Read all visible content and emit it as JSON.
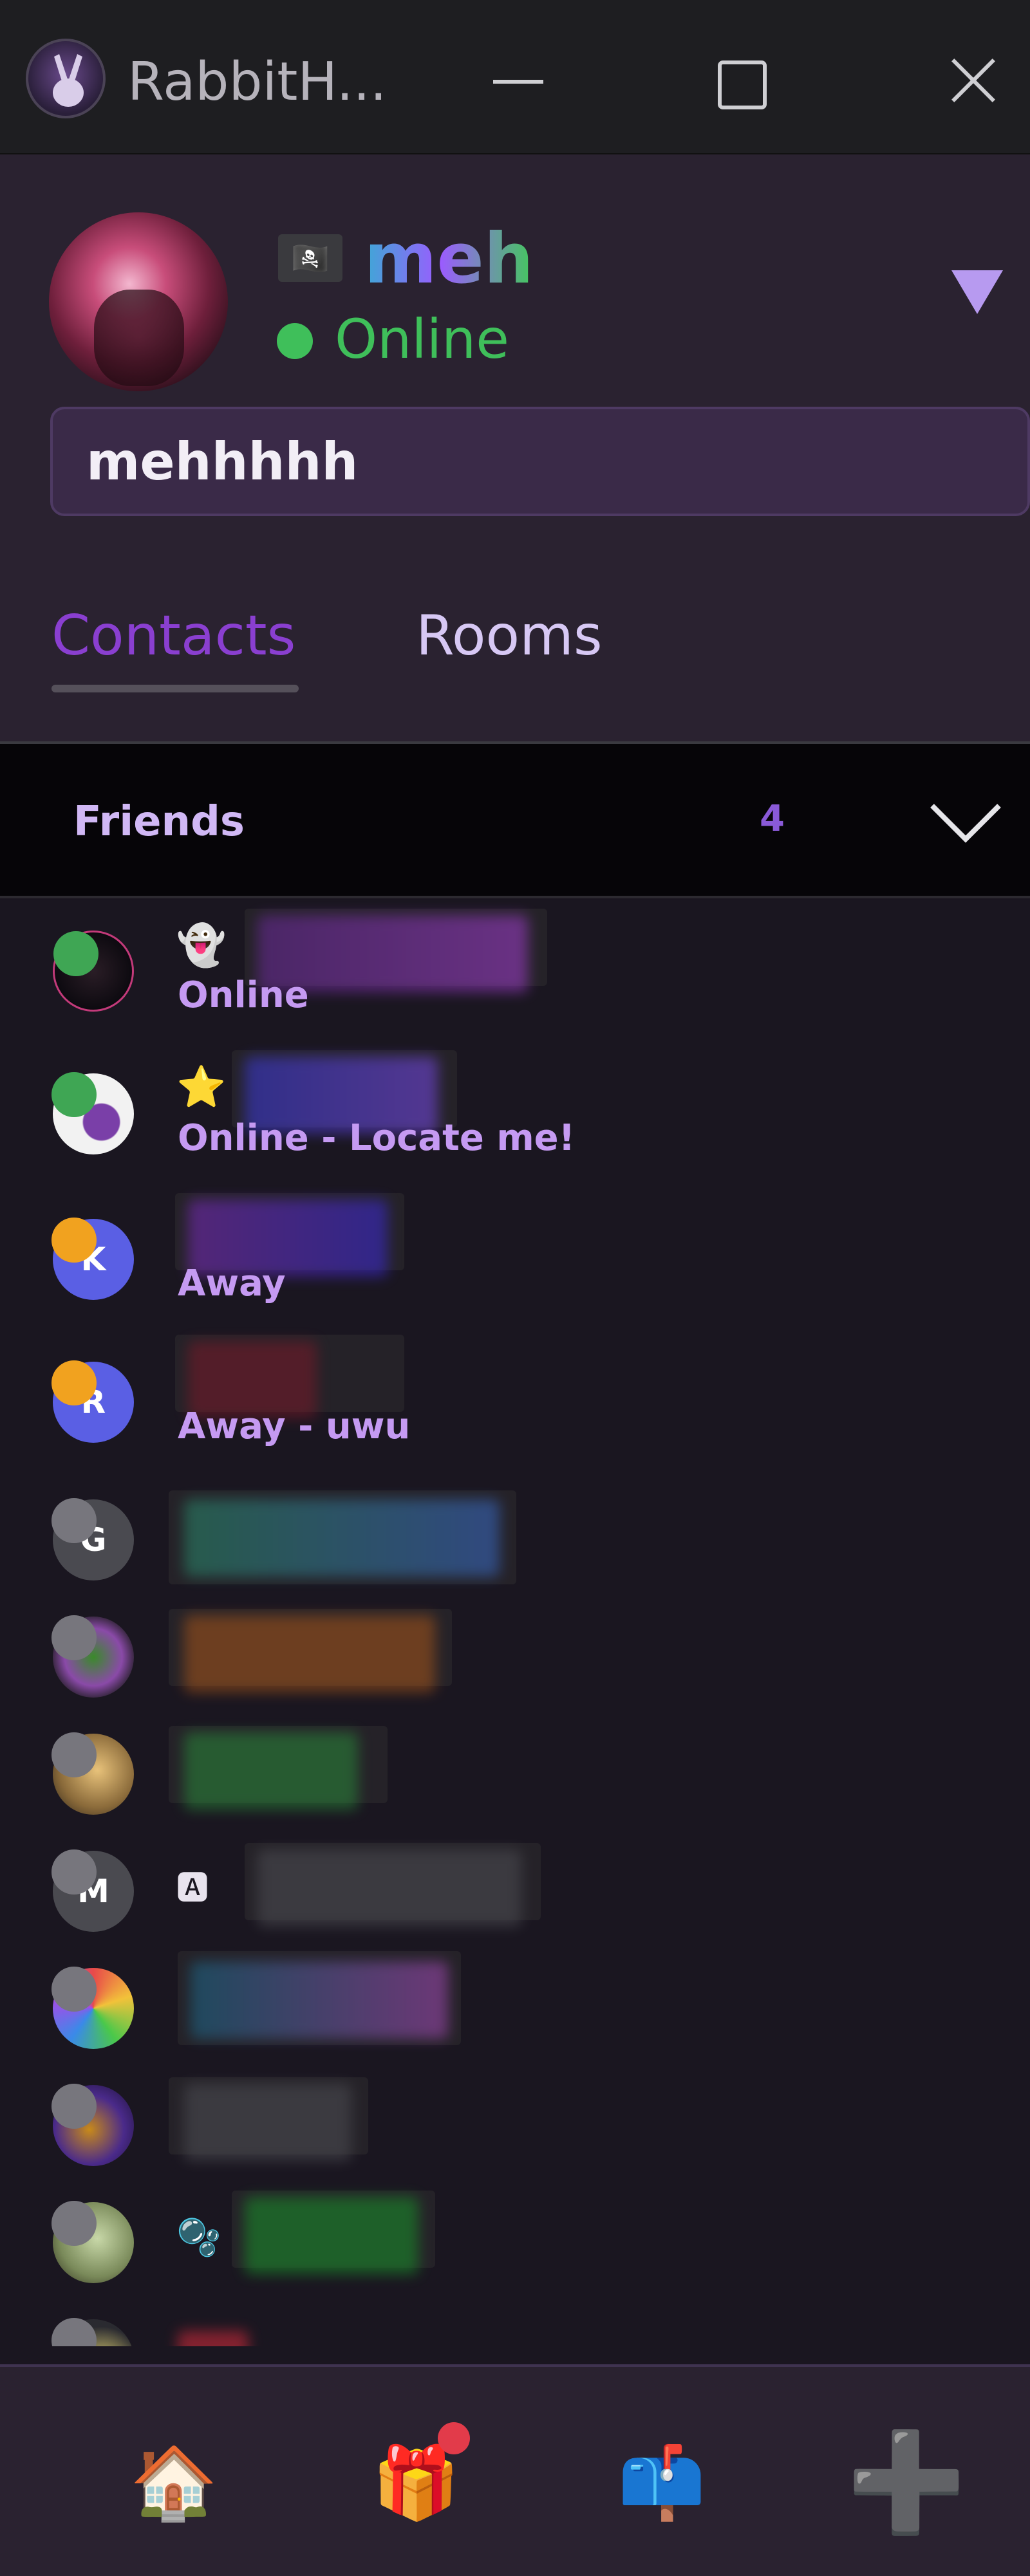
{
  "window": {
    "title": "RabbitH...",
    "icon": "rabbit-icon"
  },
  "profile": {
    "flag_icon": "🏴‍☠️",
    "username": "meh",
    "status": "Online",
    "status_color": "#3fbf5a",
    "status_message": "mehhhhh"
  },
  "tabs": [
    {
      "label": "Contacts",
      "active": true
    },
    {
      "label": "Rooms",
      "active": false
    }
  ],
  "friends": {
    "label": "Friends",
    "count": "4"
  },
  "contacts": [
    {
      "emoji": "👻",
      "status": "online",
      "subtitle": "Online",
      "avatar_letter": ""
    },
    {
      "emoji": "⭐",
      "status": "online",
      "subtitle": "Online - Locate me!",
      "avatar_letter": ""
    },
    {
      "emoji": "",
      "status": "away",
      "subtitle": "Away",
      "avatar_letter": "K"
    },
    {
      "emoji": "",
      "status": "away",
      "subtitle": "Away - uwu",
      "avatar_letter": "R"
    },
    {
      "emoji": "",
      "status": "offline",
      "subtitle": "",
      "avatar_letter": "G"
    },
    {
      "emoji": "",
      "status": "offline",
      "subtitle": "",
      "avatar_letter": ""
    },
    {
      "emoji": "",
      "status": "offline",
      "subtitle": "",
      "avatar_letter": ""
    },
    {
      "emoji": "🅰",
      "status": "offline",
      "subtitle": "",
      "avatar_letter": "M"
    },
    {
      "emoji": "",
      "status": "offline",
      "subtitle": "",
      "avatar_letter": ""
    },
    {
      "emoji": "",
      "status": "offline",
      "subtitle": "",
      "avatar_letter": ""
    },
    {
      "emoji": "🫧",
      "status": "offline",
      "subtitle": "",
      "avatar_letter": ""
    },
    {
      "emoji": "",
      "status": "offline",
      "subtitle": "",
      "avatar_letter": ""
    }
  ],
  "bottom_nav": [
    {
      "name": "home",
      "icon": "🏠"
    },
    {
      "name": "gifts",
      "icon": "🎁"
    },
    {
      "name": "mail",
      "icon": "📫"
    },
    {
      "name": "add",
      "icon": "➕"
    }
  ],
  "colors": {
    "accent": "#8a3fd0",
    "online": "#3fa654",
    "away": "#f1a21f",
    "offline": "#77767d"
  }
}
